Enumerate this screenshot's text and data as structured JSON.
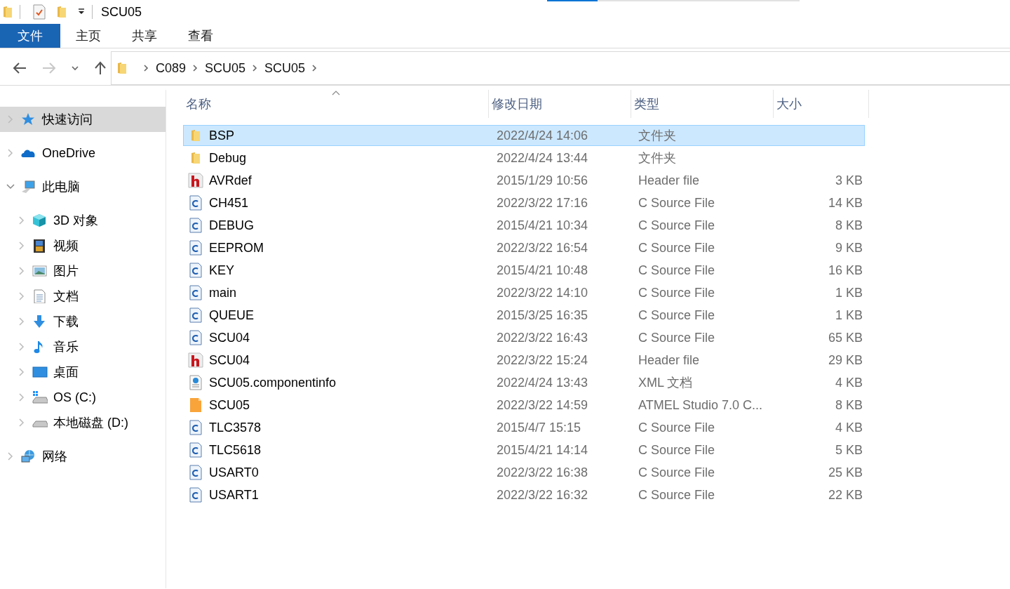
{
  "window": {
    "title": "SCU05"
  },
  "progress": {
    "level": 0.2
  },
  "ribbon_tabs": [
    {
      "label": "文件",
      "selected": true
    },
    {
      "label": "主页",
      "selected": false
    },
    {
      "label": "共享",
      "selected": false
    },
    {
      "label": "查看",
      "selected": false
    }
  ],
  "nav": {
    "back": {
      "disabled": false
    },
    "forward": {
      "disabled": true
    },
    "up": {
      "disabled": false
    }
  },
  "breadcrumb": [
    "C089",
    "SCU05",
    "SCU05"
  ],
  "sidebar": {
    "items": [
      {
        "label": "快速访问",
        "kind": "star",
        "selected": true,
        "expanded": false
      },
      {
        "label": "OneDrive",
        "kind": "cloud",
        "selected": false,
        "expanded": false
      },
      {
        "label": "此电脑",
        "kind": "computer",
        "selected": false,
        "expanded": true,
        "children": [
          {
            "label": "3D 对象",
            "kind": "cube",
            "selected": false,
            "expanded": false
          },
          {
            "label": "视频",
            "kind": "film",
            "selected": false,
            "expanded": false
          },
          {
            "label": "图片",
            "kind": "picture",
            "selected": false,
            "expanded": false
          },
          {
            "label": "文档",
            "kind": "document",
            "selected": false,
            "expanded": false
          },
          {
            "label": "下载",
            "kind": "download",
            "selected": false,
            "expanded": false
          },
          {
            "label": "音乐",
            "kind": "music",
            "selected": false,
            "expanded": false
          },
          {
            "label": "桌面",
            "kind": "desktop",
            "selected": false,
            "expanded": false
          },
          {
            "label": "OS (C:)",
            "kind": "system-drive",
            "selected": false,
            "expanded": false
          },
          {
            "label": "本地磁盘 (D:)",
            "kind": "drive",
            "selected": false,
            "expanded": false
          }
        ]
      },
      {
        "label": "网络",
        "kind": "network",
        "selected": false,
        "expanded": false
      }
    ]
  },
  "table": {
    "columns": [
      {
        "label": "名称",
        "sorted": true
      },
      {
        "label": "修改日期",
        "sorted": false
      },
      {
        "label": "类型",
        "sorted": false
      },
      {
        "label": "大小",
        "sorted": false
      }
    ],
    "rows": [
      {
        "kind": "folder",
        "name": "BSP",
        "modified": "2022/4/24 14:06",
        "type": "文件夹",
        "selected": true
      },
      {
        "kind": "folder",
        "name": "Debug",
        "modified": "2022/4/24 13:44",
        "type": "文件夹",
        "selected": false
      },
      {
        "kind": "header",
        "name": "AVRdef",
        "modified": "2015/1/29 10:56",
        "type": "Header file",
        "size": "3 KB",
        "selected": false
      },
      {
        "kind": "c",
        "name": "CH451",
        "modified": "2022/3/22 17:16",
        "type": "C Source File",
        "size": "14 KB",
        "selected": false
      },
      {
        "kind": "c",
        "name": "DEBUG",
        "modified": "2015/4/21 10:34",
        "type": "C Source File",
        "size": "8 KB",
        "selected": false
      },
      {
        "kind": "c",
        "name": "EEPROM",
        "modified": "2022/3/22 16:54",
        "type": "C Source File",
        "size": "9 KB",
        "selected": false
      },
      {
        "kind": "c",
        "name": "KEY",
        "modified": "2015/4/21 10:48",
        "type": "C Source File",
        "size": "16 KB",
        "selected": false
      },
      {
        "kind": "c",
        "name": "main",
        "modified": "2022/3/22 14:10",
        "type": "C Source File",
        "size": "1 KB",
        "selected": false
      },
      {
        "kind": "c",
        "name": "QUEUE",
        "modified": "2015/3/25 16:35",
        "type": "C Source File",
        "size": "1 KB",
        "selected": false
      },
      {
        "kind": "c",
        "name": "SCU04",
        "modified": "2022/3/22 16:43",
        "type": "C Source File",
        "size": "65 KB",
        "selected": false
      },
      {
        "kind": "header",
        "name": "SCU04",
        "modified": "2022/3/22 15:24",
        "type": "Header file",
        "size": "29 KB",
        "selected": false
      },
      {
        "kind": "xml",
        "name": "SCU05.componentinfo",
        "modified": "2022/4/24 13:43",
        "type": "XML 文档",
        "size": "4 KB",
        "selected": false
      },
      {
        "kind": "project",
        "name": "SCU05",
        "modified": "2022/3/22 14:59",
        "type": "ATMEL Studio 7.0 C...",
        "size": "8 KB",
        "selected": false
      },
      {
        "kind": "c",
        "name": "TLC3578",
        "modified": "2015/4/7 15:15",
        "type": "C Source File",
        "size": "4 KB",
        "selected": false
      },
      {
        "kind": "c",
        "name": "TLC5618",
        "modified": "2015/4/21 14:14",
        "type": "C Source File",
        "size": "5 KB",
        "selected": false
      },
      {
        "kind": "c",
        "name": "USART0",
        "modified": "2022/3/22 16:38",
        "type": "C Source File",
        "size": "25 KB",
        "selected": false
      },
      {
        "kind": "c",
        "name": "USART1",
        "modified": "2022/3/22 16:32",
        "type": "C Source File",
        "size": "22 KB",
        "selected": false
      }
    ]
  }
}
